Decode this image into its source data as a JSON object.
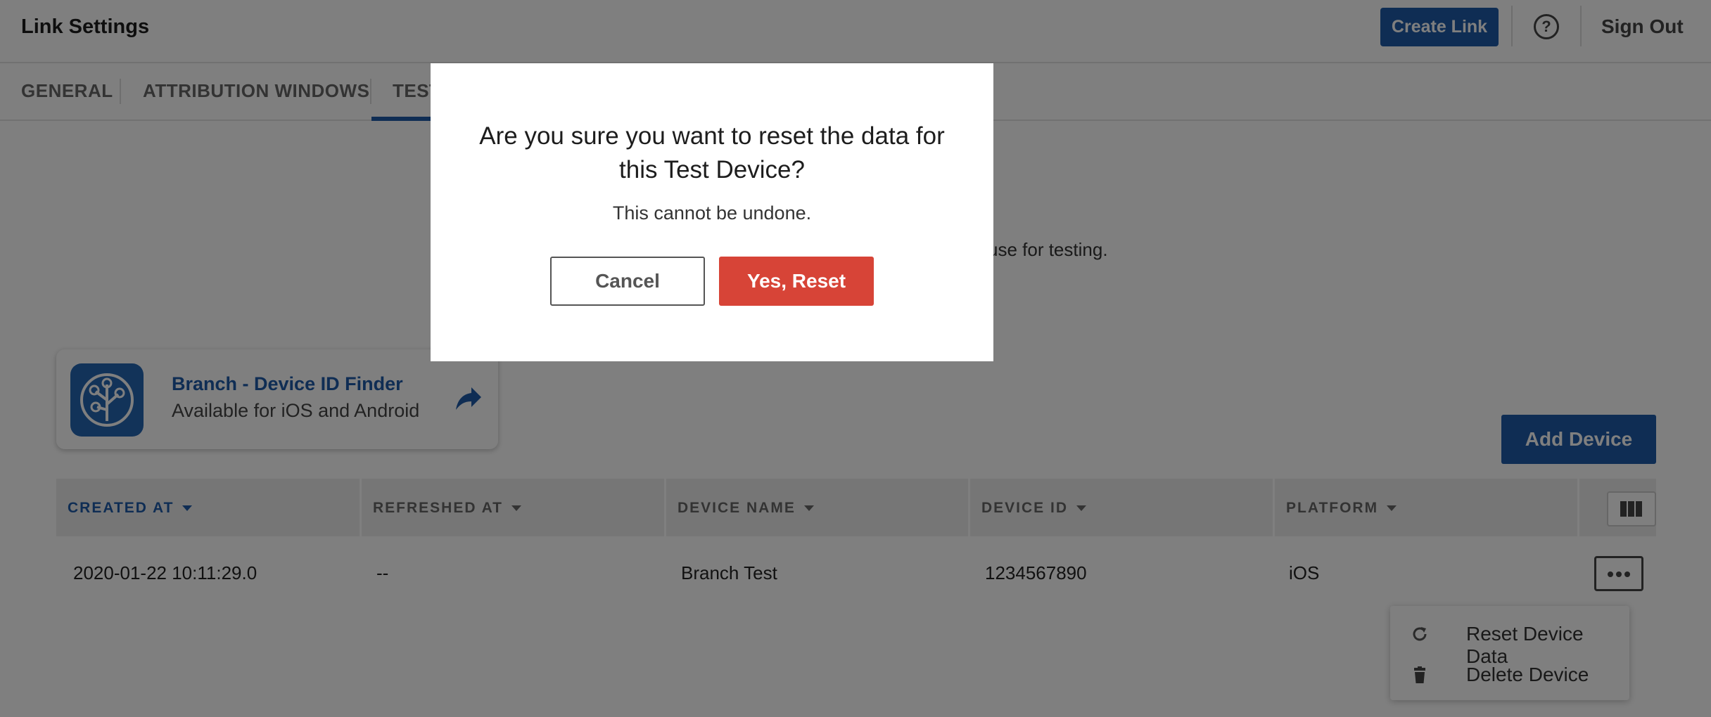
{
  "header": {
    "title": "Link Settings",
    "create_link_label": "Create Link",
    "help_symbol": "?",
    "sign_out_label": "Sign Out",
    "accent_color": "#1e5ba8"
  },
  "tabs": [
    {
      "label": "GENERAL"
    },
    {
      "label": "ATTRIBUTION WINDOWS"
    },
    {
      "label": "TEST",
      "active": true
    }
  ],
  "background_text": "use for testing.",
  "app_card": {
    "name": "Branch - Device ID Finder",
    "subtitle": "Available for iOS and Android",
    "icon": "branch-tree-icon"
  },
  "add_device_label": "Add Device",
  "table": {
    "columns": [
      {
        "label": "CREATED AT",
        "sorted": true
      },
      {
        "label": "REFRESHED AT"
      },
      {
        "label": "DEVICE NAME"
      },
      {
        "label": "DEVICE ID"
      },
      {
        "label": "PLATFORM"
      }
    ],
    "rows": [
      {
        "created_at": "2020-01-22 10:11:29.0",
        "refreshed_at": "--",
        "device_name": "Branch Test",
        "device_id": "1234567890",
        "platform": "iOS"
      }
    ]
  },
  "row_menu": {
    "items": [
      {
        "label": "Reset Device Data",
        "icon": "refresh-icon"
      },
      {
        "label": "Delete Device",
        "icon": "trash-icon"
      }
    ]
  },
  "modal": {
    "title": "Are you sure you want to reset the data for this Test Device?",
    "subtitle": "This cannot be undone.",
    "cancel_label": "Cancel",
    "confirm_label": "Yes, Reset",
    "confirm_color": "#d74437"
  }
}
